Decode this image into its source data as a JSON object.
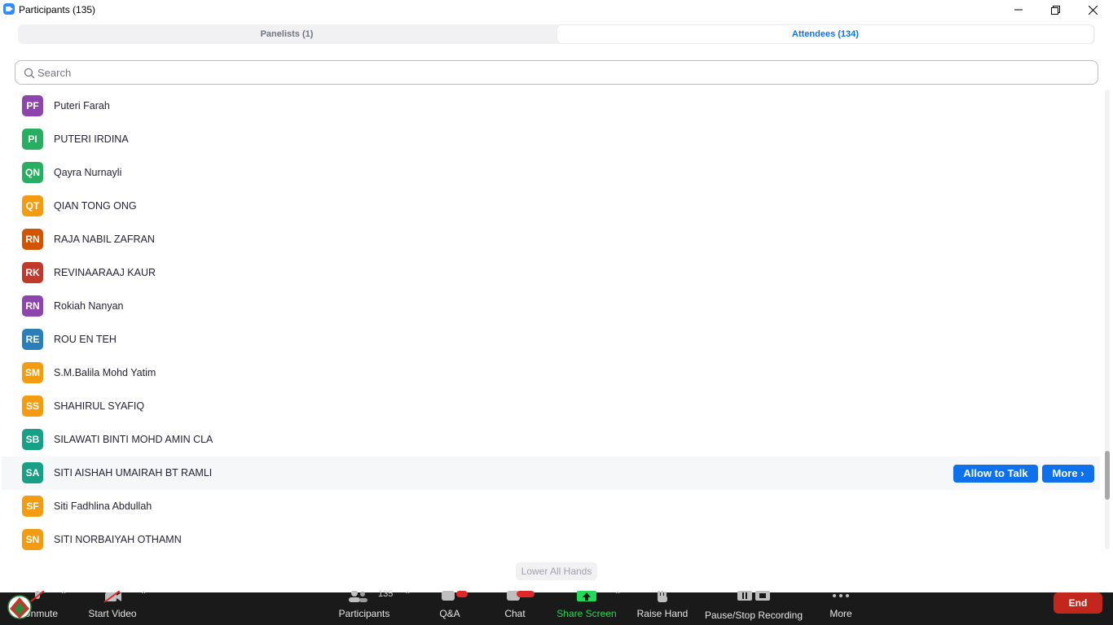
{
  "window": {
    "title": "Participants (135)"
  },
  "tabs": {
    "panelists": "Panelists (1)",
    "attendees": "Attendees (134)"
  },
  "search": {
    "placeholder": "Search",
    "value": ""
  },
  "participants": [
    {
      "initials": "PF",
      "name": "Puteri Farah",
      "color": "#8e44ad"
    },
    {
      "initials": "PI",
      "name": "PUTERI IRDINA",
      "color": "#27ae60"
    },
    {
      "initials": "QN",
      "name": "Qayra Nurnayli",
      "color": "#27ae60"
    },
    {
      "initials": "QT",
      "name": "QIAN TONG ONG",
      "color": "#f39c12"
    },
    {
      "initials": "RN",
      "name": "RAJA NABIL ZAFRAN",
      "color": "#d35400"
    },
    {
      "initials": "RK",
      "name": "REVINAARAAJ KAUR",
      "color": "#c0392b"
    },
    {
      "initials": "RN",
      "name": "Rokiah Nanyan",
      "color": "#8e44ad"
    },
    {
      "initials": "RE",
      "name": "ROU EN TEH",
      "color": "#2980b9"
    },
    {
      "initials": "SM",
      "name": "S.M.Balila Mohd Yatim",
      "color": "#f39c12"
    },
    {
      "initials": "SS",
      "name": "SHAHIRUL SYAFIQ",
      "color": "#f39c12"
    },
    {
      "initials": "SB",
      "name": "SILAWATI BINTI MOHD AMIN CLA",
      "color": "#16a085"
    },
    {
      "initials": "SA",
      "name": "SITI AISHAH UMAIRAH BT RAMLI",
      "color": "#16a085"
    },
    {
      "initials": "SF",
      "name": "Siti Fadhlina Abdullah",
      "color": "#f39c12"
    },
    {
      "initials": "SN",
      "name": "SITI NORBAIYAH OTHAMN",
      "color": "#f39c12"
    }
  ],
  "hovered_row": {
    "allow_label": "Allow to Talk",
    "more_label": "More"
  },
  "lower_all_hands": "Lower All Hands",
  "toolbar": {
    "unmute": "Unmute",
    "start_video": "Start Video",
    "participants": "Participants",
    "participants_count": "135",
    "qa": "Q&A",
    "chat": "Chat",
    "share_screen": "Share Screen",
    "raise_hand": "Raise Hand",
    "recording": "Pause/Stop Recording",
    "more": "More",
    "end": "End"
  },
  "colors": {
    "accent": "#0e71eb",
    "share_green": "#23d959",
    "end_red": "#c2261d",
    "toolbar_bg": "#1a1a1a"
  }
}
